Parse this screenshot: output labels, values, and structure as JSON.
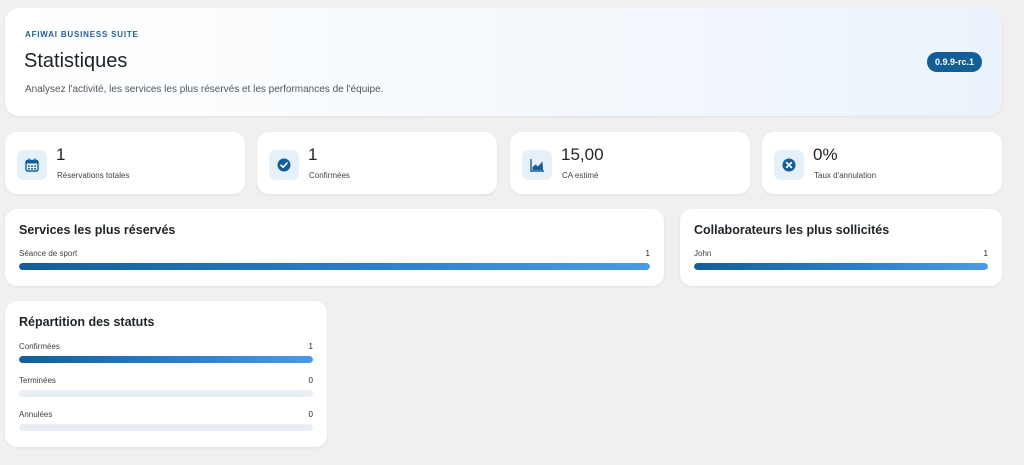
{
  "header": {
    "eyebrow": "AFIWAI BUSINESS SUITE",
    "title": "Statistiques",
    "subtitle": "Analysez l'activité, les services les plus réservés et les performances de l'équipe.",
    "version": "0.9.9-rc.1"
  },
  "kpis": [
    {
      "value": "1",
      "label": "Réservations totales",
      "icon": "calendar-icon"
    },
    {
      "value": "1",
      "label": "Confirmées",
      "icon": "check-circle-icon"
    },
    {
      "value": "15,00",
      "label": "CA estimé",
      "icon": "chart-area-icon"
    },
    {
      "value": "0%",
      "label": "Taux d'annulation",
      "icon": "cancel-circle-icon"
    }
  ],
  "services": {
    "title": "Services les plus réservés",
    "rows": [
      {
        "label": "Séance de sport",
        "count": "1",
        "fill_fraction": 1
      }
    ]
  },
  "staff": {
    "title": "Collaborateurs les plus sollicités",
    "rows": [
      {
        "label": "John",
        "count": "1",
        "fill_fraction": 1
      }
    ]
  },
  "statuses": {
    "title": "Répartition des statuts",
    "rows": [
      {
        "label": "Confirmées",
        "count": "1",
        "fill_fraction": 1
      },
      {
        "label": "Terminées",
        "count": "0",
        "fill_fraction": 0
      },
      {
        "label": "Annulées",
        "count": "0",
        "fill_fraction": 0
      }
    ]
  },
  "colors": {
    "accent": "#135e96",
    "bar_light": "#4a9be6",
    "track": "#e9eef4",
    "background": "#f0f0f1"
  }
}
